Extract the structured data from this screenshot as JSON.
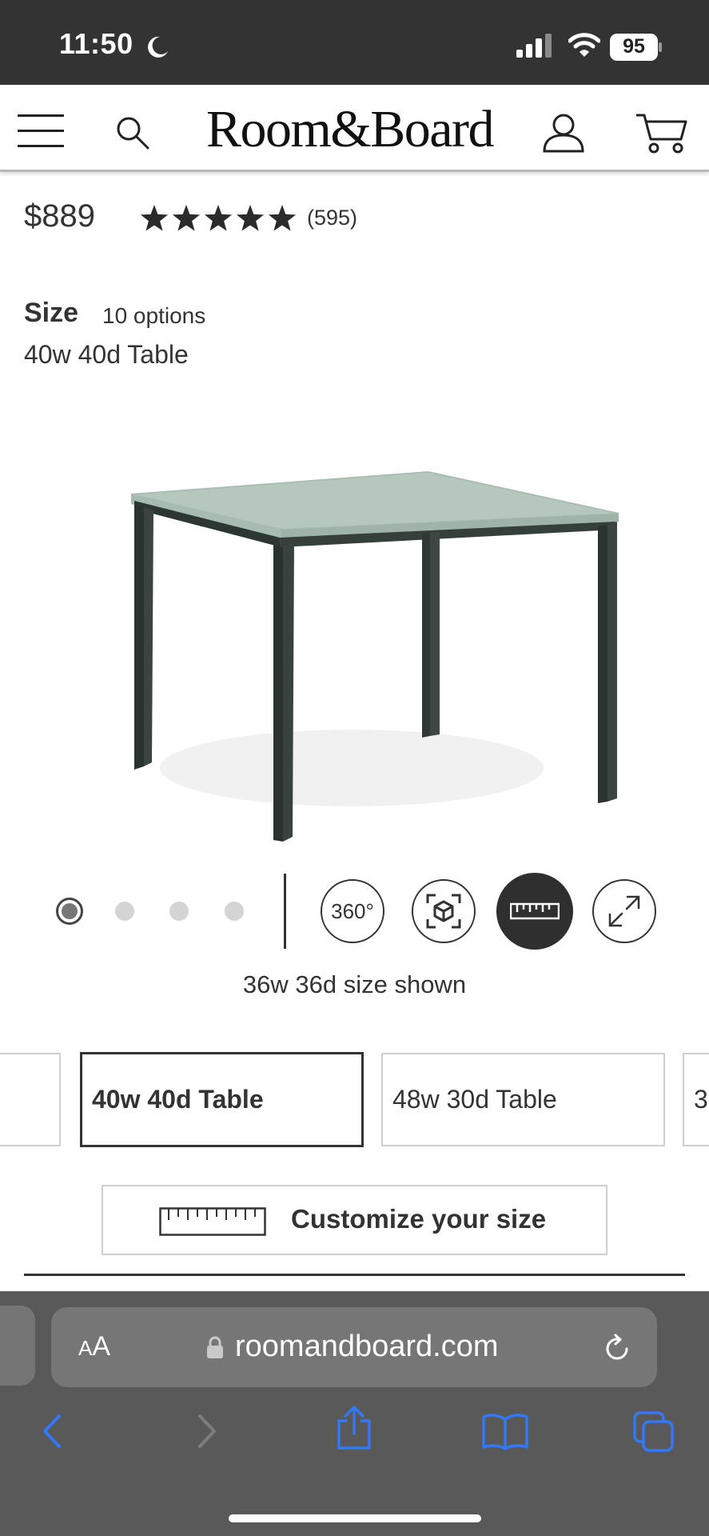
{
  "status_bar": {
    "time": "11:50",
    "battery": "95"
  },
  "header": {
    "logo": "Room&Board"
  },
  "product": {
    "price": "$889",
    "rating_stars": 5,
    "review_count": "(595)",
    "size_label": "Size",
    "size_options_count": "10 options",
    "selected_size": "40w 40d Table"
  },
  "gallery": {
    "controls": {
      "spin_label": "360°"
    },
    "caption": "36w 36d size shown",
    "active_slide": 1,
    "slide_count": 4
  },
  "size_options": {
    "prev_label": "",
    "selected_label": "40w 40d Table",
    "next_label": "48w 30d Table",
    "partial_label": "3"
  },
  "customize": {
    "label": "Customize your size"
  },
  "browser": {
    "aa_label_small": "A",
    "aa_label": "A",
    "url": "roomandboard.com"
  },
  "colors": {
    "accent": "#3478f6",
    "dark": "#2f2f2f",
    "status_bar": "#333333",
    "toolbar": "#595959"
  }
}
